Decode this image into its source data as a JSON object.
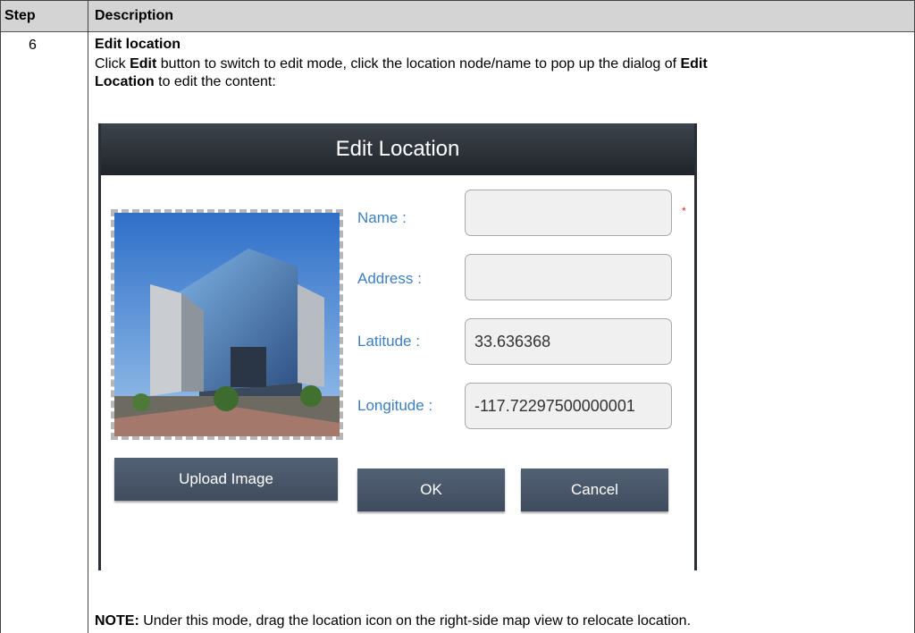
{
  "table": {
    "header": {
      "step": "Step",
      "description": "Description"
    },
    "step_number": "6",
    "title": "Edit location",
    "instruction": {
      "part1": "Click ",
      "edit_word": "Edit",
      "part2": " button to switch to edit mode, click the location node/name to pop up the dialog of ",
      "edit_word2": "Edit",
      "location_word": "Location",
      "part3": " to edit the content:"
    },
    "note_label": "NOTE:",
    "note_text": " Under this mode, drag the location icon on the right-side map view to relocate location."
  },
  "dialog": {
    "title": "Edit Location",
    "required_marker": "*",
    "fields": {
      "name": {
        "label": "Name :",
        "value": ""
      },
      "address": {
        "label": "Address :",
        "value": ""
      },
      "latitude": {
        "label": "Latitude :",
        "value": "33.636368"
      },
      "longitude": {
        "label": "Longitude :",
        "value": "-117.72297500000001"
      }
    },
    "upload_label": "Upload Image",
    "ok_label": "OK",
    "cancel_label": "Cancel"
  },
  "colors": {
    "header_bg": "#d4d4d4",
    "dialog_header": "#2a2f36",
    "label_blue": "#3d7fc0",
    "button": "#4a586b"
  }
}
